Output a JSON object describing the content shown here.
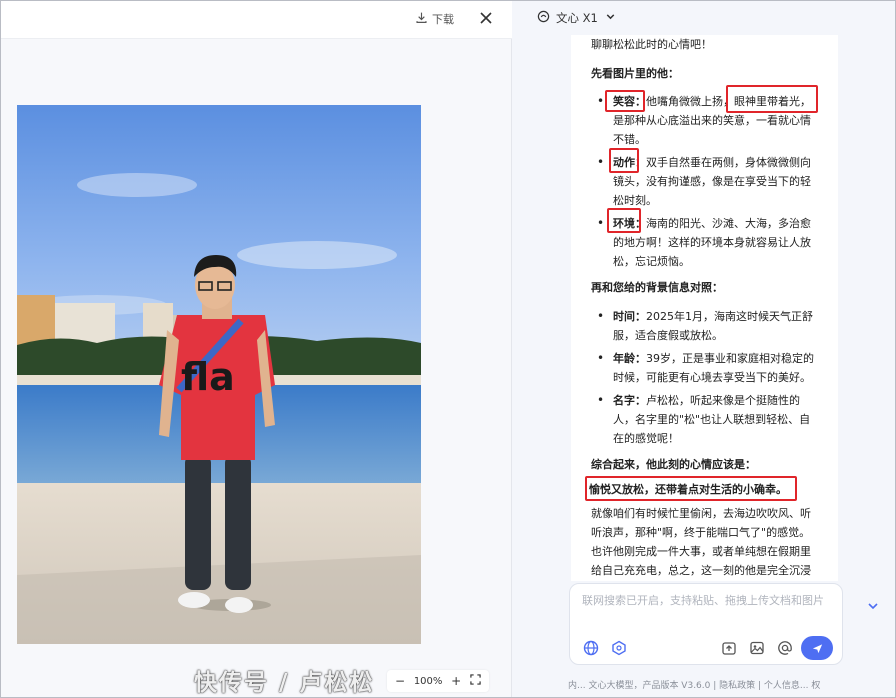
{
  "toolbar": {
    "download_label": "下载"
  },
  "zoom": {
    "minus": "−",
    "level": "100%",
    "plus": "+"
  },
  "model": {
    "name": "文心 X1"
  },
  "chat": {
    "intro": "聊聊松松此时的心情吧！",
    "section1_title": "先看图片里的他：",
    "section1_items": [
      {
        "label": "笑容：",
        "text": "他嘴角微微上扬，眼神里带着光，是那种从心底溢出来的笑意，一看就心情不错。"
      },
      {
        "label": "动作：",
        "text": "双手自然垂在两侧，身体微微侧向镜头，没有拘谨感，像是在享受当下的轻松时刻。"
      },
      {
        "label": "环境：",
        "text": "海南的阳光、沙滩、大海，多治愈的地方啊！这样的环境本身就容易让人放松，忘记烦恼。"
      }
    ],
    "section2_title": "再和您给的背景信息对照：",
    "section2_items": [
      {
        "label": "时间：",
        "text": "2025年1月，海南这时候天气正舒服，适合度假或放松。"
      },
      {
        "label": "年龄：",
        "text": "39岁，正是事业和家庭相对稳定的时候，可能更有心境去享受当下的美好。"
      },
      {
        "label": "名字：",
        "text": "卢松松，听起来像是个挺随性的人，名字里的\"松\"也让人联想到轻松、自在的感觉呢！"
      }
    ],
    "section3_title": "综合起来，他此刻的心情应该是：",
    "conclusion": "愉悦又放松，还带着点对生活的小确幸。",
    "closing": "就像咱们有时候忙里偷闲，去海边吹吹风、听听浪声，那种\"啊，终于能喘口气了\"的感觉。也许他刚完成一件大事，或者单纯想在假期里给自己充充电，总之，这一刻的他是完全沉浸"
  },
  "input": {
    "placeholder": "联网搜索已开启，支持粘贴、拖拽上传文档和图片"
  },
  "footer": {
    "text": "内... 文心大模型，产品版本 V3.6.0 | 隐私政策 | 个人信息... 权"
  },
  "watermark": {
    "text": "快传号 / 卢松松"
  },
  "photo": {
    "shirt_text": "fla"
  },
  "colors": {
    "accent": "#4e6ef2",
    "highlight": "#e0252a"
  },
  "icons": [
    "download-icon",
    "close-icon",
    "zoom-out",
    "zoom-in",
    "fit-screen-icon",
    "model-logo-icon",
    "chevron-down-icon",
    "globe-icon",
    "plugin-icon",
    "upload-icon",
    "image-icon",
    "at-icon",
    "send-icon"
  ]
}
